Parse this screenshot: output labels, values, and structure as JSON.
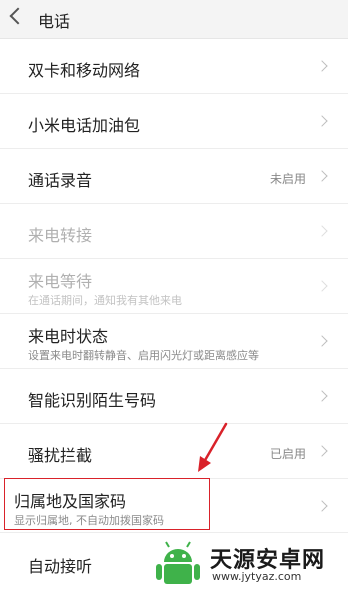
{
  "header": {
    "title": "电话"
  },
  "items": [
    {
      "label": "双卡和移动网络"
    },
    {
      "label": "小米电话加油包"
    },
    {
      "label": "通话录音",
      "value": "未启用"
    },
    {
      "label": "来电转接"
    },
    {
      "label": "来电等待",
      "sub": "在通话期间，通知我有其他来电"
    },
    {
      "label": "来电时状态",
      "sub": "设置来电时翻转静音、启用闪光灯或距离感应等"
    },
    {
      "label": "智能识别陌生号码"
    },
    {
      "label": "骚扰拦截",
      "value": "已启用"
    },
    {
      "label": "归属地及国家码",
      "sub": "显示归属地, 不自动加拨国家码"
    },
    {
      "label": "自动接听"
    }
  ],
  "watermark": {
    "name": "天源安卓网",
    "url": "www.jytyaz.com"
  },
  "colors": {
    "highlight": "#d9222a",
    "logo_green": "#3fb24a"
  }
}
